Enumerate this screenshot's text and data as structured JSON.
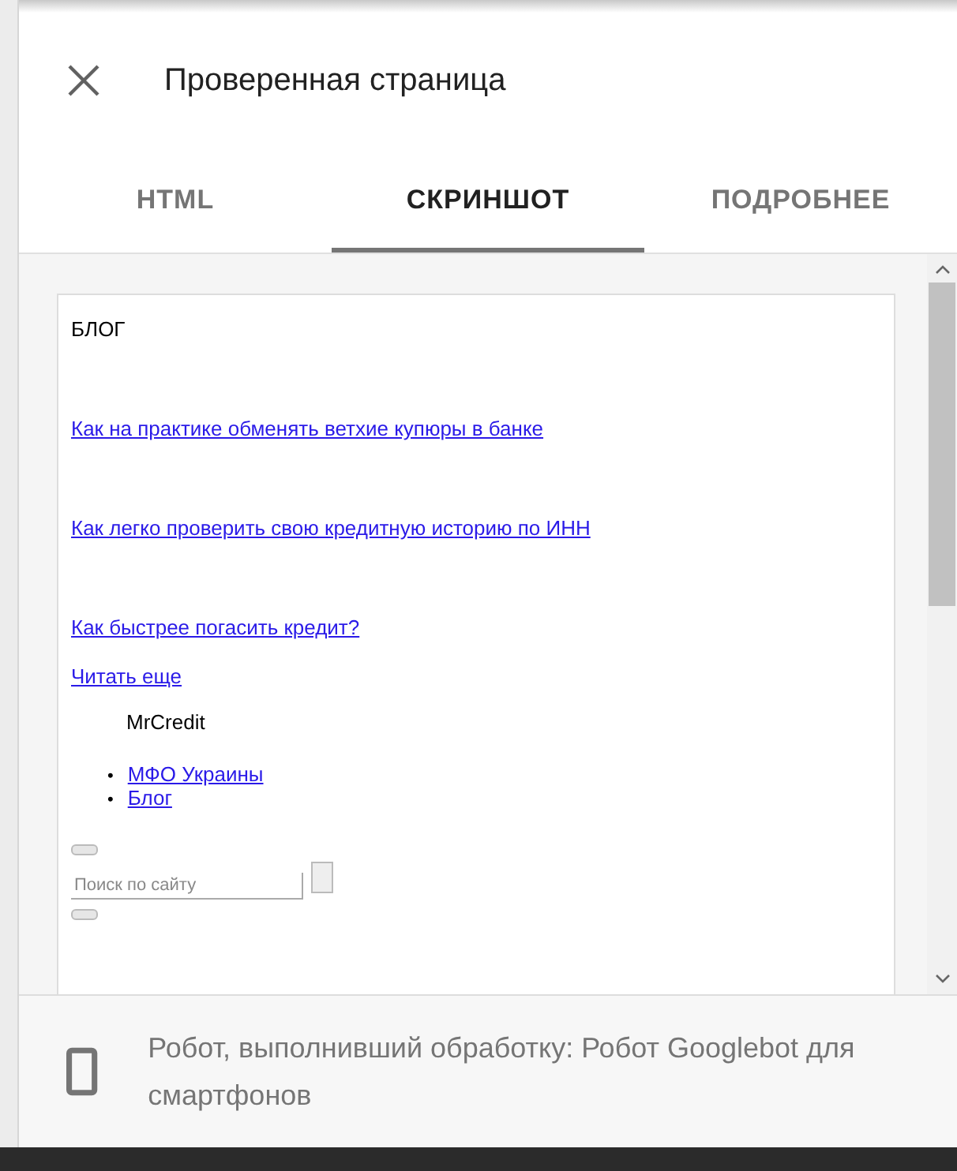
{
  "dialog": {
    "title": "Проверенная страница"
  },
  "tabs": [
    {
      "label": "HTML",
      "selected": false
    },
    {
      "label": "СКРИНШОТ",
      "selected": true
    },
    {
      "label": "ПОДРОБНЕЕ",
      "selected": false
    }
  ],
  "preview": {
    "heading": "БЛОГ",
    "articles": [
      "Как на практике обменять ветхие купюры в банке",
      "Как легко проверить свою кредитную историю по ИНН",
      "Как быстрее погасить кредит?"
    ],
    "more_link": "Читать еще",
    "brand": "MrCredit",
    "nav_items": [
      {
        "marker": "•",
        "label": "МФО Украины"
      },
      {
        "marker": "•",
        "label": "Блог"
      }
    ],
    "search": {
      "placeholder": "Поиск по сайту"
    }
  },
  "footer": {
    "text": "Робот, выполнивший обработку: Робот Googlebot для смартфонов"
  }
}
